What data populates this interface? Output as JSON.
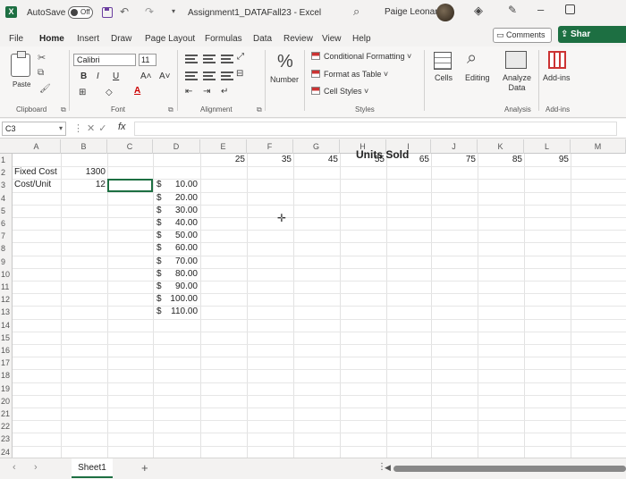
{
  "titlebar": {
    "autosave_label": "AutoSave",
    "autosave_state": "Off",
    "doc_title": "Assignment1_DATAFall23  -  Excel",
    "user_name": "Paige Leonard"
  },
  "tabs": [
    "File",
    "Home",
    "Insert",
    "Draw",
    "Page Layout",
    "Formulas",
    "Data",
    "Review",
    "View",
    "Help"
  ],
  "active_tab": "Home",
  "header_buttons": {
    "comments": "Comments",
    "share": "Shar"
  },
  "ribbon": {
    "clipboard": {
      "paste": "Paste",
      "group": "Clipboard"
    },
    "font": {
      "name": "Calibri",
      "size": "11",
      "group": "Font",
      "bold": "B",
      "italic": "I",
      "underline": "U",
      "grow": "A˄",
      "shrink": "A˅"
    },
    "alignment": {
      "group": "Alignment"
    },
    "number": {
      "label": "Number"
    },
    "styles": {
      "conditional": "Conditional Formatting ˅",
      "format_table": "Format as Table ˅",
      "cell_styles": "Cell Styles ˅",
      "group": "Styles"
    },
    "cells": {
      "label": "Cells"
    },
    "editing": {
      "label": "Editing"
    },
    "analyze": {
      "label": "Analyze Data",
      "group": "Analysis"
    },
    "addins": {
      "label": "Add-ins",
      "group": "Add-ins"
    }
  },
  "formula_bar": {
    "name_box": "C3",
    "fx": "fx",
    "value": ""
  },
  "grid": {
    "columns": [
      "A",
      "B",
      "C",
      "D",
      "E",
      "F",
      "G",
      "H",
      "I",
      "J",
      "K",
      "L",
      "M"
    ],
    "rows": [
      "1",
      "2",
      "3",
      "4",
      "5",
      "6",
      "7",
      "8",
      "9",
      "10",
      "11",
      "12",
      "13",
      "14",
      "15",
      "16",
      "17",
      "18",
      "19",
      "20",
      "21",
      "22",
      "23",
      "24"
    ],
    "cells": {
      "A2": "Fixed Cost",
      "B2": "1300",
      "A3": "Cost/Unit",
      "B3": "12",
      "H1": "Units Sold",
      "E2": "25",
      "F2": "35",
      "G2": "45",
      "H2": "55",
      "I2": "65",
      "J2": "75",
      "K2": "85",
      "L2": "95"
    },
    "currency_symbol": "$",
    "d_values": [
      "10.00",
      "20.00",
      "30.00",
      "40.00",
      "50.00",
      "60.00",
      "70.00",
      "80.00",
      "90.00",
      "100.00",
      "110.00"
    ]
  },
  "sheets": [
    "Sheet1"
  ],
  "accent_color": "#1d6f42"
}
